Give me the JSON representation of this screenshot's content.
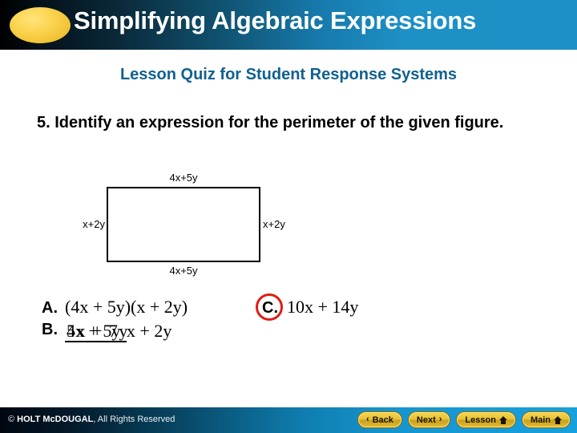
{
  "header": {
    "title": "Simplifying Algebraic Expressions",
    "ellipse_color": "#f2c73a",
    "gradient_start": "#000000",
    "gradient_end": "#1d91c7"
  },
  "subtitle": {
    "text": "Lesson Quiz for Student Response Systems",
    "color": "#10618f"
  },
  "question": {
    "number": "5.",
    "text": "Identify an expression for the perimeter of the given figure."
  },
  "figure": {
    "shape": "rectangle",
    "label_top": "4x+5y",
    "label_bottom": "4x+5y",
    "label_left": "x+2y",
    "label_right": "x+2y"
  },
  "answers": {
    "a": {
      "letter": "A.",
      "expression": "(4x + 5y)(x + 2y)"
    },
    "b": {
      "letter": "B.",
      "numerator_layer1": "4x + 5y",
      "numerator_layer2": "5x + 7y",
      "denominator": "x + 2y"
    },
    "c": {
      "letter": "C.",
      "expression": "10x + 14y",
      "circled": "true",
      "circle_color": "#e01b16"
    }
  },
  "footer": {
    "copyright_symbol": "© ",
    "brand": "HOLT McDOUGAL",
    "rights": ", All Rights Reserved",
    "buttons": [
      {
        "label": "Back",
        "icon": "chevron-left",
        "glyph": "‹"
      },
      {
        "label": "Next",
        "icon": "chevron-right",
        "glyph": "›"
      },
      {
        "label": "Lesson",
        "icon": "home"
      },
      {
        "label": "Main",
        "icon": "home"
      }
    ]
  }
}
